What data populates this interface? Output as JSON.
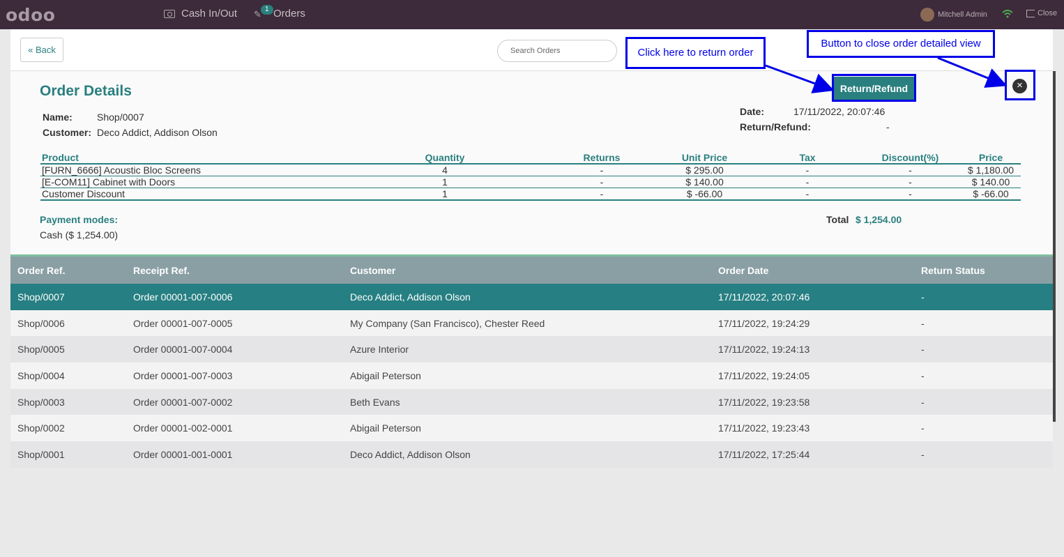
{
  "topbar": {
    "logo": "odoo",
    "cash_label": "Cash In/Out",
    "orders_label": "Orders",
    "orders_badge": "1",
    "user_name": "Mitchell Admin",
    "close_label": "Close"
  },
  "controls": {
    "back_label": "Back",
    "search_placeholder": "Search Orders"
  },
  "details": {
    "title": "Order Details",
    "name_label": "Name:",
    "name_value": "Shop/0007",
    "customer_label": "Customer:",
    "customer_value": "Deco Addict, Addison Olson",
    "date_label": "Date:",
    "date_value": "17/11/2022, 20:07:46",
    "return_label": "Return/Refund:",
    "return_value": "-",
    "return_button": "Return/Refund",
    "close_icon": "×",
    "line_headers": [
      "Product",
      "Quantity",
      "Returns",
      "Unit Price",
      "Tax",
      "Discount(%)",
      "Price"
    ],
    "lines": [
      [
        "[FURN_6666] Acoustic Bloc Screens",
        "4",
        "-",
        "$ 295.00",
        "-",
        "-",
        "$ 1,180.00"
      ],
      [
        "[E-COM11] Cabinet with Doors",
        "1",
        "-",
        "$ 140.00",
        "-",
        "-",
        "$ 140.00"
      ],
      [
        "Customer Discount",
        "1",
        "-",
        "$ -66.00",
        "-",
        "-",
        "$ -66.00"
      ]
    ],
    "payment_label": "Payment modes:",
    "payment_value": "Cash ($ 1,254.00)",
    "total_label": "Total",
    "total_value": "$ 1,254.00"
  },
  "orders": {
    "headers": [
      "Order Ref.",
      "Receipt Ref.",
      "Customer",
      "Order Date",
      "Return Status"
    ],
    "rows": [
      [
        "Shop/0007",
        "Order 00001-007-0006",
        "Deco Addict, Addison Olson",
        "17/11/2022, 20:07:46",
        "-"
      ],
      [
        "Shop/0006",
        "Order 00001-007-0005",
        "My Company (San Francisco), Chester Reed",
        "17/11/2022, 19:24:29",
        "-"
      ],
      [
        "Shop/0005",
        "Order 00001-007-0004",
        "Azure Interior",
        "17/11/2022, 19:24:13",
        "-"
      ],
      [
        "Shop/0004",
        "Order 00001-007-0003",
        "Abigail Peterson",
        "17/11/2022, 19:24:05",
        "-"
      ],
      [
        "Shop/0003",
        "Order 00001-007-0002",
        "Beth Evans",
        "17/11/2022, 19:23:58",
        "-"
      ],
      [
        "Shop/0002",
        "Order 00001-002-0001",
        "Abigail Peterson",
        "17/11/2022, 19:23:43",
        "-"
      ],
      [
        "Shop/0001",
        "Order 00001-001-0001",
        "Deco Addict, Addison Olson",
        "17/11/2022, 17:25:44",
        "-"
      ]
    ]
  },
  "annotations": {
    "return_hint": "Click here to return order",
    "close_hint": "Button to close order detailed view"
  },
  "colors": {
    "accent": "#2a7f7f",
    "topbar": "#3d2a3a",
    "annotation": "#0000e8",
    "table_header": "#8a9fa4"
  }
}
